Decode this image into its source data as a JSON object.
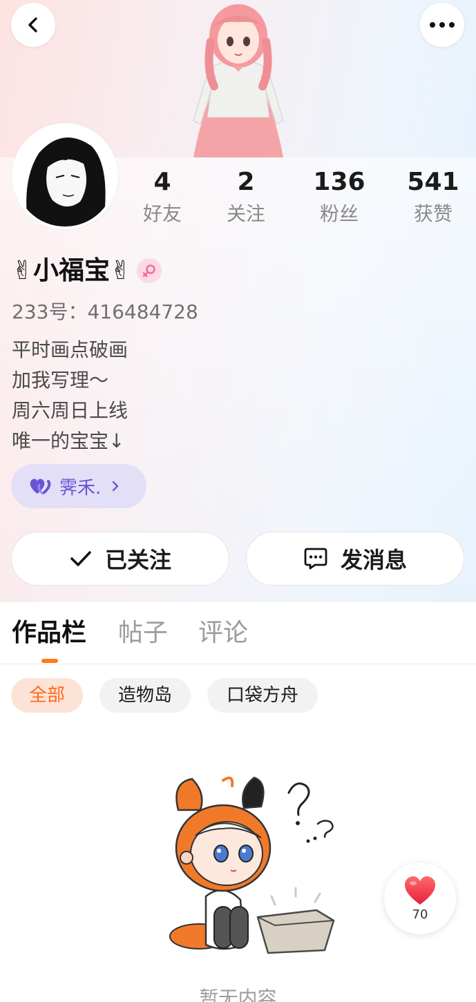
{
  "header": {
    "back_icon": "chevron-left-icon",
    "more_icon": "more-horizontal-icon"
  },
  "profile": {
    "nickname": "✌小福宝✌",
    "gender_icon": "female-icon",
    "uid": "233号：416484728",
    "bio_lines": [
      "平时画点破画",
      "加我写理～",
      "周六周日上线",
      "唯一的宝宝↓"
    ],
    "guard": {
      "icon": "heart-pair-icon",
      "name": "霁禾."
    }
  },
  "stats": [
    {
      "value": "4",
      "label": "好友"
    },
    {
      "value": "2",
      "label": "关注"
    },
    {
      "value": "136",
      "label": "粉丝"
    },
    {
      "value": "541",
      "label": "获赞"
    }
  ],
  "actions": {
    "follow_label": "已关注",
    "message_label": "发消息"
  },
  "tabs": [
    {
      "label": "作品栏",
      "active": true
    },
    {
      "label": "帖子",
      "active": false
    },
    {
      "label": "评论",
      "active": false
    }
  ],
  "filters": [
    {
      "label": "全部",
      "active": true
    },
    {
      "label": "造物岛",
      "active": false
    },
    {
      "label": "口袋方舟",
      "active": false
    }
  ],
  "empty_state": {
    "text": "暂无内容"
  },
  "like_float": {
    "icon": "heart-icon",
    "count": "70"
  },
  "colors": {
    "accent": "#ff7a1a",
    "purple": "#6b53d6",
    "heart": "#f2354a"
  }
}
